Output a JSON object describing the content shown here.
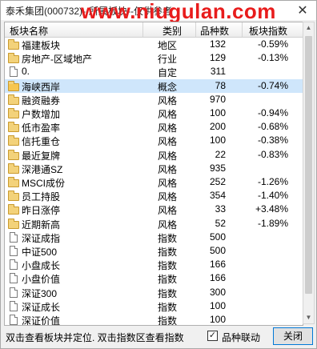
{
  "window": {
    "title": "泰禾集团(000732)--所属板块--仅供参考",
    "watermark": "www.niugulan.com",
    "close_glyph": "✕"
  },
  "table": {
    "headers": {
      "name": "板块名称",
      "category": "类别",
      "count": "品种数",
      "index_pct": "板块指数"
    },
    "rows": [
      {
        "icon": "folder",
        "name": "福建板块",
        "category": "地区",
        "count": "132",
        "pct": "-0.59%"
      },
      {
        "icon": "folder",
        "name": "房地产-区域地产",
        "category": "行业",
        "count": "129",
        "pct": "-0.13%"
      },
      {
        "icon": "doc",
        "name": "0.",
        "category": "自定",
        "count": "311",
        "pct": ""
      },
      {
        "icon": "folder-open",
        "name": "海峡西岸",
        "category": "概念",
        "count": "78",
        "pct": "-0.74%"
      },
      {
        "icon": "folder",
        "name": "融资融券",
        "category": "风格",
        "count": "970",
        "pct": ""
      },
      {
        "icon": "folder",
        "name": "户数增加",
        "category": "风格",
        "count": "100",
        "pct": "-0.94%"
      },
      {
        "icon": "folder",
        "name": "低市盈率",
        "category": "风格",
        "count": "200",
        "pct": "-0.68%"
      },
      {
        "icon": "folder",
        "name": "信托重仓",
        "category": "风格",
        "count": "100",
        "pct": "-0.38%"
      },
      {
        "icon": "folder",
        "name": "最近复牌",
        "category": "风格",
        "count": "22",
        "pct": "-0.83%"
      },
      {
        "icon": "folder",
        "name": "深港通SZ",
        "category": "风格",
        "count": "935",
        "pct": ""
      },
      {
        "icon": "folder",
        "name": "MSCI成份",
        "category": "风格",
        "count": "252",
        "pct": "-1.26%"
      },
      {
        "icon": "folder",
        "name": "员工持股",
        "category": "风格",
        "count": "354",
        "pct": "-1.40%"
      },
      {
        "icon": "folder",
        "name": "昨日涨停",
        "category": "风格",
        "count": "33",
        "pct": "+3.48%"
      },
      {
        "icon": "folder",
        "name": "近期新高",
        "category": "风格",
        "count": "52",
        "pct": "-1.89%"
      },
      {
        "icon": "doc",
        "name": "深证成指",
        "category": "指数",
        "count": "500",
        "pct": ""
      },
      {
        "icon": "doc",
        "name": "中证500",
        "category": "指数",
        "count": "500",
        "pct": ""
      },
      {
        "icon": "doc",
        "name": "小盘成长",
        "category": "指数",
        "count": "166",
        "pct": ""
      },
      {
        "icon": "doc",
        "name": "小盘价值",
        "category": "指数",
        "count": "166",
        "pct": ""
      },
      {
        "icon": "doc",
        "name": "深证300",
        "category": "指数",
        "count": "300",
        "pct": ""
      },
      {
        "icon": "doc",
        "name": "深证成长",
        "category": "指数",
        "count": "100",
        "pct": ""
      },
      {
        "icon": "doc",
        "name": "深证价值",
        "category": "指数",
        "count": "100",
        "pct": ""
      }
    ]
  },
  "footer": {
    "hint": "双击查看板块并定位. 双击指数区查看指数",
    "checkbox_label": "品种联动",
    "checkbox_checked": true,
    "checkbox_glyph": "✓",
    "close_button": "关闭"
  },
  "scrollbar": {
    "up_glyph": "▲",
    "down_glyph": "▼"
  }
}
